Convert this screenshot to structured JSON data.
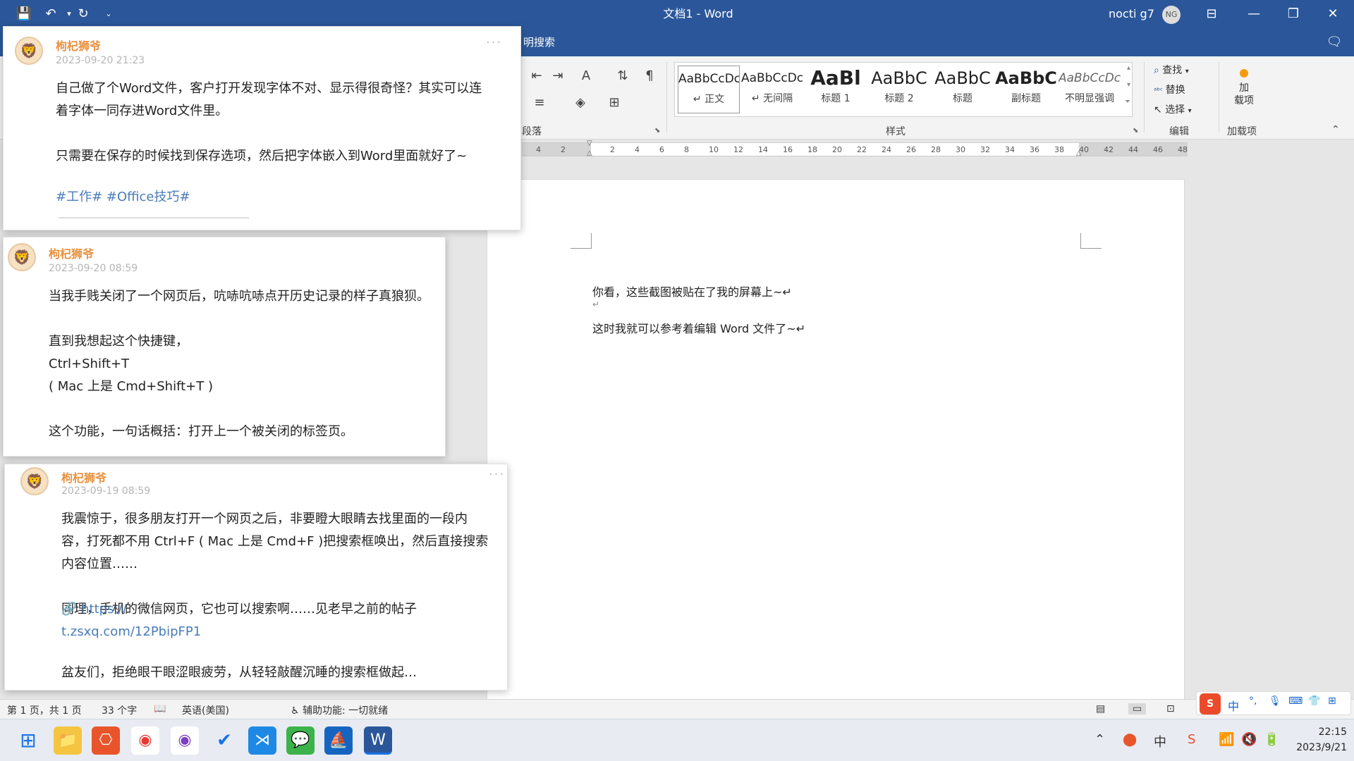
{
  "window": {
    "title": "文档1 - Word",
    "user": "nocti g7",
    "user_initials": "NG"
  },
  "ribbon": {
    "tell_me": "明搜索",
    "styles": [
      {
        "sample": "AaBbCcDc",
        "name": "↵ 正文"
      },
      {
        "sample": "AaBbCcDc",
        "name": "↵ 无间隔"
      },
      {
        "sample": "AaBl",
        "name": "标题 1"
      },
      {
        "sample": "AaBbC",
        "name": "标题 2"
      },
      {
        "sample": "AaBbC",
        "name": "标题"
      },
      {
        "sample": "AaBbC",
        "name": "副标题"
      },
      {
        "sample": "AaBbCcDc",
        "name": "不明显强调"
      }
    ],
    "groups": {
      "paragraph": "段落",
      "styles": "样式",
      "editing": "编辑",
      "addins": "加载项"
    },
    "editing": {
      "find": "查找",
      "replace": "替换",
      "select": "选择"
    },
    "addins_button": "加\n载项"
  },
  "ruler": {
    "labels": [
      "4",
      "2",
      "",
      "2",
      "4",
      "6",
      "8",
      "10",
      "12",
      "14",
      "16",
      "18",
      "20",
      "22",
      "24",
      "26",
      "28",
      "30",
      "32",
      "34",
      "36",
      "38",
      "40",
      "42",
      "44",
      "46",
      "48"
    ]
  },
  "document": {
    "lines": [
      "你看，这些截图被贴在了我的屏幕上~↵",
      "↵",
      "这时我就可以参考着编辑 Word 文件了~↵"
    ]
  },
  "pinned_cards": [
    {
      "author": "枸杞狮爷",
      "date": "2023-09-20 21:23",
      "body": "自己做了个Word文件，客户打开发现字体不对、显示得很奇怪？其实可以连\n着字体一同存进Word文件里。\n\n只需要在保存的时候找到保存选项，然后把字体嵌入到Word里面就好了~",
      "tags": "#工作# #Office技巧#"
    },
    {
      "author": "枸杞狮爷",
      "date": "2023-09-20 08:59",
      "body": "当我手贱关闭了一个网页后，吭哧吭哧点开历史记录的样子真狼狈。\n\n直到我想起这个快捷键，\nCtrl+Shift+T\n( Mac 上是 Cmd+Shift+T )\n\n这个功能，一句话概括：打开上一个被关闭的标签页。"
    },
    {
      "author": "枸杞狮爷",
      "date": "2023-09-19 08:59",
      "body": "我震惊于，很多朋友打开一个网页之后，非要瞪大眼睛去找里面的一段内\n容，打死都不用 Ctrl+F ( Mac 上是 Cmd+F )把搜索框唤出，然后直接搜索\n内容位置……\n\n同理，手机的微信网页，它也可以搜索啊……见老早之前的帖子",
      "link": "🔗 https://\nt.zsxq.com/12PbipFP1",
      "body2": "盆友们，拒绝眼干眼涩眼疲劳，从轻轻敲醒沉睡的搜索框做起…"
    }
  ],
  "statusbar": {
    "page": "第 1 页，共 1 页",
    "words": "33 个字",
    "language": "英语(美国)",
    "accessibility": "辅助功能: 一切就绪"
  },
  "taskbar": {
    "time": "22:15",
    "date": "2023/9/21",
    "ime": "中"
  }
}
